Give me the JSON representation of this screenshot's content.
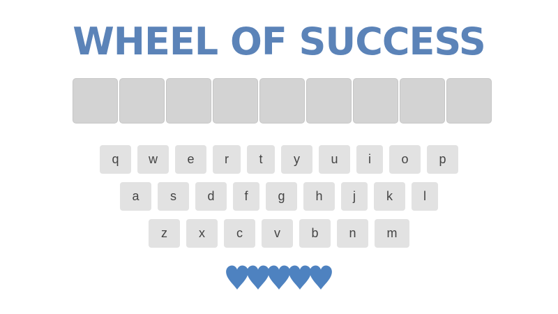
{
  "game": {
    "title": "WHEEL OF SUCCESS",
    "accent_color": "#5b83b8",
    "tile_count": 9,
    "tile_color": "#d3d3d3",
    "key_color": "#e2e2e2",
    "keyboard": {
      "rows": [
        [
          "q",
          "w",
          "e",
          "r",
          "t",
          "y",
          "u",
          "i",
          "o",
          "p"
        ],
        [
          "a",
          "s",
          "d",
          "f",
          "g",
          "h",
          "j",
          "k",
          "l"
        ],
        [
          "z",
          "x",
          "c",
          "v",
          "b",
          "n",
          "m"
        ]
      ]
    },
    "lives": {
      "count": 5,
      "icon": "heart-icon",
      "color": "#4e82c0"
    }
  }
}
